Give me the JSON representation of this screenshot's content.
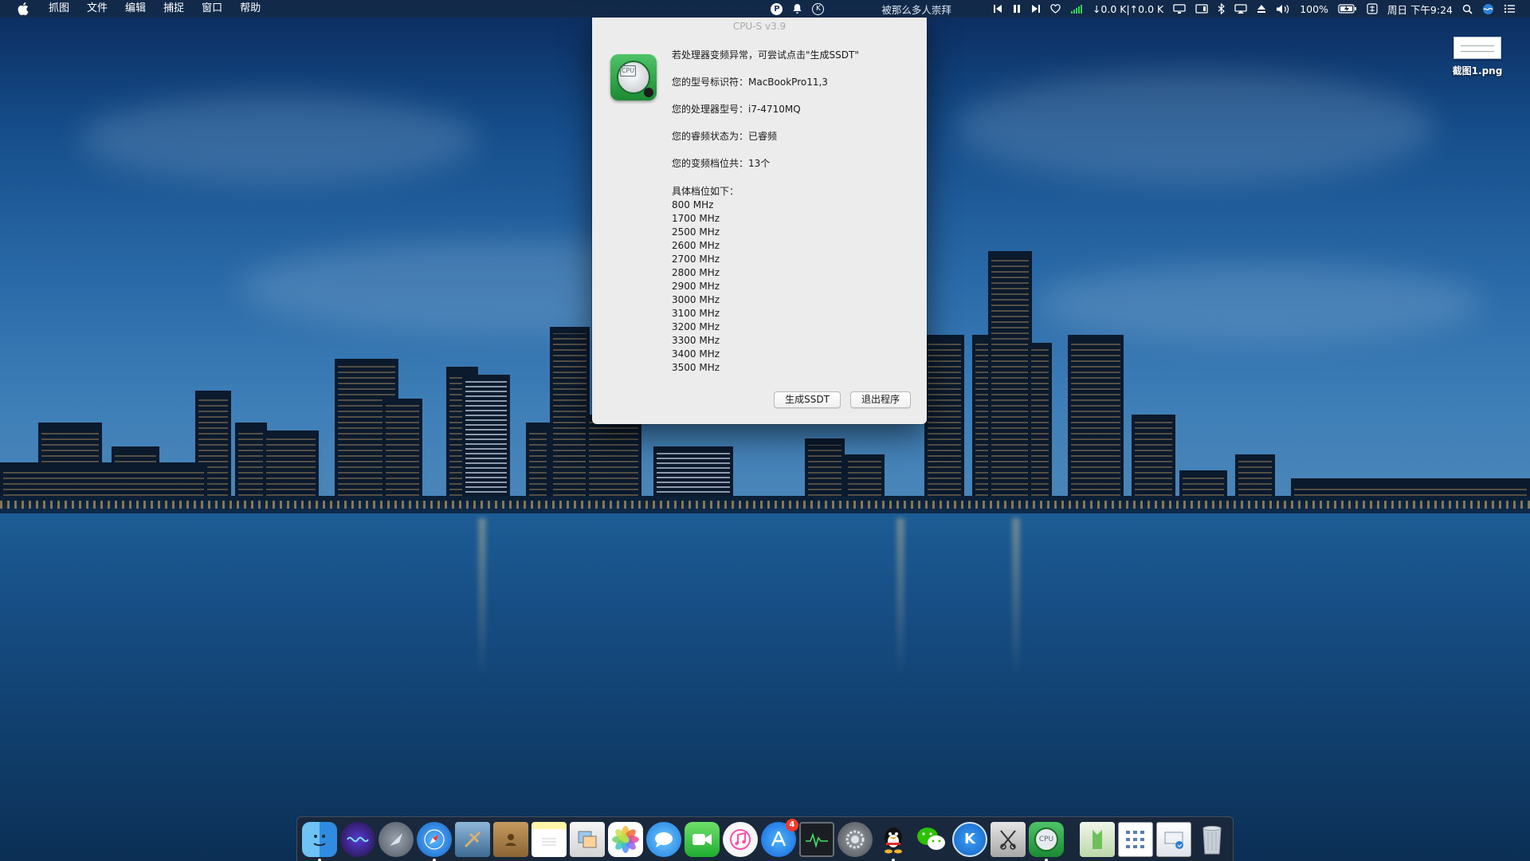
{
  "menubar": {
    "app_menus": [
      "抓图",
      "文件",
      "编辑",
      "捕捉",
      "窗口",
      "帮助"
    ],
    "status": {
      "song": "被那么多人崇拜",
      "network": "↓0.0 K|↑0.0 K",
      "battery": "100%",
      "datetime": "周日 下午9:24"
    }
  },
  "desktop": {
    "file_name": "截图1.png"
  },
  "dialog": {
    "title": "CPU-S v3.9",
    "hint": "若处理器变频异常，可尝试点击\"生成SSDT\"",
    "model_line": "您的型号标识符：MacBookPro11,3",
    "cpu_line": "您的处理器型号：i7-4710MQ",
    "turbo_line": "您的睿频状态为：已睿频",
    "steps_line": "您的变频档位共：13个",
    "detail_header": "具体档位如下：",
    "frequencies": [
      "800 MHz",
      "1700 MHz",
      "2500 MHz",
      "2600 MHz",
      "2700 MHz",
      "2800 MHz",
      "2900 MHz",
      "3000 MHz",
      "3100 MHz",
      "3200 MHz",
      "3300 MHz",
      "3400 MHz",
      "3500 MHz"
    ],
    "buttons": {
      "generate": "生成SSDT",
      "quit": "退出程序"
    },
    "icon_label": "CPU"
  },
  "dock": {
    "app_store_badge": "4",
    "cpu_icon_label": "CPU",
    "k_icon_label": "K"
  },
  "colors": {
    "menubar_bg": "#142a46",
    "dialog_bg": "#ececec",
    "icon_green": "#1b8a34"
  }
}
